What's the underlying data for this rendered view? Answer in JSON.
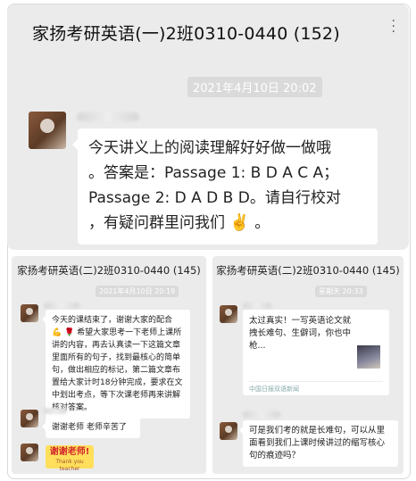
{
  "main": {
    "title": "家扬考研英语(一)2班0310-0440 (152)",
    "timestamp": "2021年4月10日 20:02",
    "message": {
      "line1": "今天讲义上的阅读理解好好做一做哦",
      "line2": "。答案是：Passage 1: B D A C A；",
      "line3": "Passage 2: D A D B D。请自行校对",
      "line4": "，有疑问群里问我们",
      "emoji": "✌️",
      "end": "。"
    }
  },
  "left_panel": {
    "title": "家扬考研英语(二)2班0310-0440 (145)",
    "timestamp": "2021年4月10日 20:19",
    "message": "今天的课结束了，谢谢大家的配合 💪 🌹 希望大家思考一下老师上课所讲的内容，再去认真读一下这篇文章里面所有的句子，找到最核心的简单句，做出相应的标记，第二篇文章布置给大家计时18分钟完成，要求在文中划出考点，等下次课老师再来讲解核对答案。",
    "reply": "谢谢老师 老师辛苦了",
    "sticker_text": "谢谢老师!",
    "sticker_sub": "Thank you teacher"
  },
  "right_panel": {
    "title": "家扬考研英语(二)2班0310-0440 (145)",
    "timestamp": "星期天 20:33",
    "card_title": "太过真实！一写英语论文就拽长难句、生僻词，你也中枪...",
    "card_source": "中国日报双语新闻",
    "message": "可是我们考的就是长难句，可以从里面看到我们上课时候讲过的缩写核心句的痕迹吗？"
  }
}
